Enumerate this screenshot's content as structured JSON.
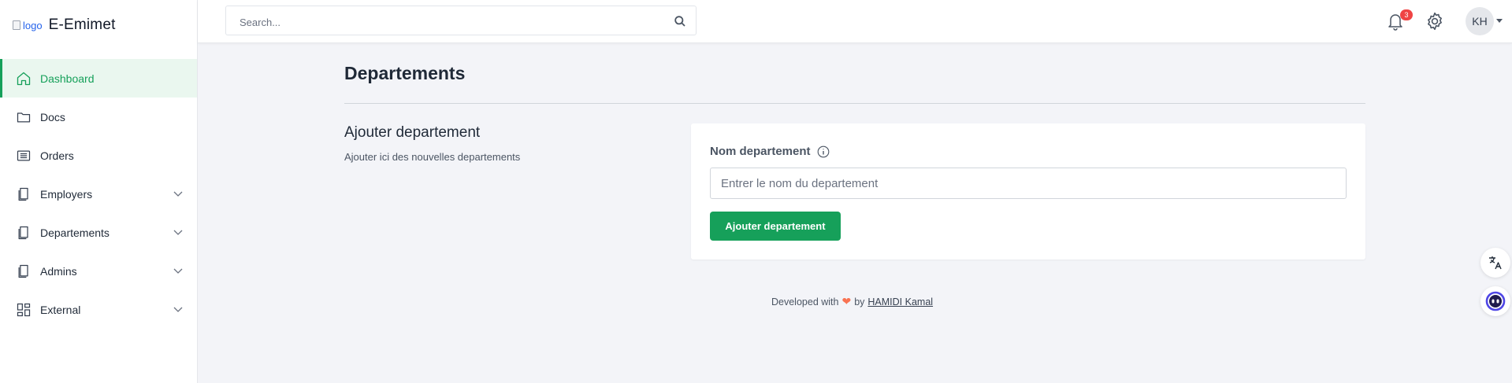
{
  "brand": {
    "logo_alt": "logo",
    "app_name": "E-Emimet"
  },
  "sidebar": {
    "items": [
      {
        "label": "Dashboard",
        "icon": "home-icon",
        "active": true,
        "expandable": false
      },
      {
        "label": "Docs",
        "icon": "folder-icon",
        "active": false,
        "expandable": false
      },
      {
        "label": "Orders",
        "icon": "list-icon",
        "active": false,
        "expandable": false
      },
      {
        "label": "Employers",
        "icon": "document-icon",
        "active": false,
        "expandable": true
      },
      {
        "label": "Departements",
        "icon": "document-icon",
        "active": false,
        "expandable": true
      },
      {
        "label": "Admins",
        "icon": "document-icon",
        "active": false,
        "expandable": true
      },
      {
        "label": "External",
        "icon": "grid-icon",
        "active": false,
        "expandable": true
      }
    ]
  },
  "topbar": {
    "search_placeholder": "Search...",
    "notification_count": "3",
    "avatar_initials": "KH"
  },
  "main": {
    "page_title": "Departements",
    "section_title": "Ajouter departement",
    "section_description": "Ajouter ici des nouvelles departements",
    "form": {
      "field_label": "Nom departement",
      "field_placeholder": "Entrer le nom du departement",
      "submit_label": "Ajouter departement"
    }
  },
  "footer": {
    "prefix": "Developed with",
    "middle": "by",
    "author": "HAMIDI Kamal"
  },
  "colors": {
    "accent": "#16a05a",
    "active_bg": "#eaf7ef",
    "badge": "#ef4444",
    "page_bg": "#f3f4f8"
  }
}
